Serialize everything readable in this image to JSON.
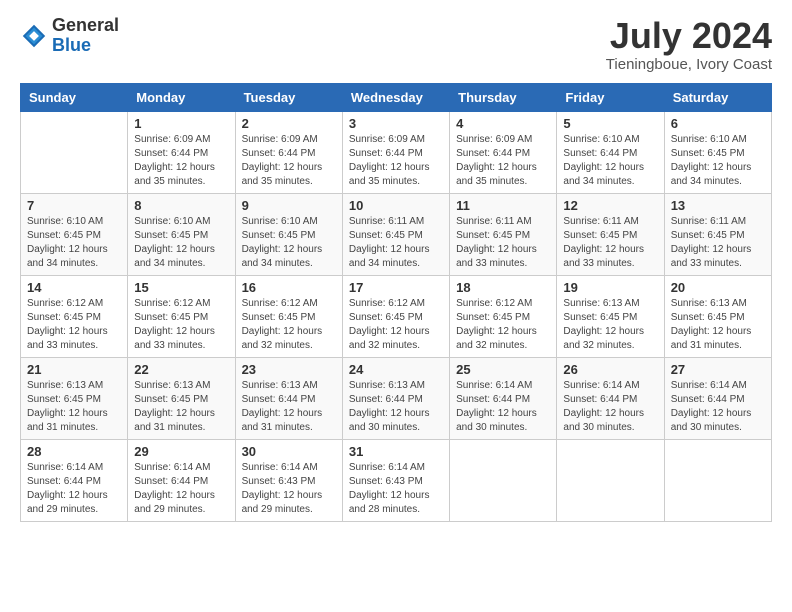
{
  "logo": {
    "general": "General",
    "blue": "Blue"
  },
  "title": "July 2024",
  "subtitle": "Tieningboue, Ivory Coast",
  "days_of_week": [
    "Sunday",
    "Monday",
    "Tuesday",
    "Wednesday",
    "Thursday",
    "Friday",
    "Saturday"
  ],
  "weeks": [
    [
      {
        "day": "",
        "sunrise": "",
        "sunset": "",
        "daylight": ""
      },
      {
        "day": "1",
        "sunrise": "Sunrise: 6:09 AM",
        "sunset": "Sunset: 6:44 PM",
        "daylight": "Daylight: 12 hours and 35 minutes."
      },
      {
        "day": "2",
        "sunrise": "Sunrise: 6:09 AM",
        "sunset": "Sunset: 6:44 PM",
        "daylight": "Daylight: 12 hours and 35 minutes."
      },
      {
        "day": "3",
        "sunrise": "Sunrise: 6:09 AM",
        "sunset": "Sunset: 6:44 PM",
        "daylight": "Daylight: 12 hours and 35 minutes."
      },
      {
        "day": "4",
        "sunrise": "Sunrise: 6:09 AM",
        "sunset": "Sunset: 6:44 PM",
        "daylight": "Daylight: 12 hours and 35 minutes."
      },
      {
        "day": "5",
        "sunrise": "Sunrise: 6:10 AM",
        "sunset": "Sunset: 6:44 PM",
        "daylight": "Daylight: 12 hours and 34 minutes."
      },
      {
        "day": "6",
        "sunrise": "Sunrise: 6:10 AM",
        "sunset": "Sunset: 6:45 PM",
        "daylight": "Daylight: 12 hours and 34 minutes."
      }
    ],
    [
      {
        "day": "7",
        "sunrise": "Sunrise: 6:10 AM",
        "sunset": "Sunset: 6:45 PM",
        "daylight": "Daylight: 12 hours and 34 minutes."
      },
      {
        "day": "8",
        "sunrise": "Sunrise: 6:10 AM",
        "sunset": "Sunset: 6:45 PM",
        "daylight": "Daylight: 12 hours and 34 minutes."
      },
      {
        "day": "9",
        "sunrise": "Sunrise: 6:10 AM",
        "sunset": "Sunset: 6:45 PM",
        "daylight": "Daylight: 12 hours and 34 minutes."
      },
      {
        "day": "10",
        "sunrise": "Sunrise: 6:11 AM",
        "sunset": "Sunset: 6:45 PM",
        "daylight": "Daylight: 12 hours and 34 minutes."
      },
      {
        "day": "11",
        "sunrise": "Sunrise: 6:11 AM",
        "sunset": "Sunset: 6:45 PM",
        "daylight": "Daylight: 12 hours and 33 minutes."
      },
      {
        "day": "12",
        "sunrise": "Sunrise: 6:11 AM",
        "sunset": "Sunset: 6:45 PM",
        "daylight": "Daylight: 12 hours and 33 minutes."
      },
      {
        "day": "13",
        "sunrise": "Sunrise: 6:11 AM",
        "sunset": "Sunset: 6:45 PM",
        "daylight": "Daylight: 12 hours and 33 minutes."
      }
    ],
    [
      {
        "day": "14",
        "sunrise": "Sunrise: 6:12 AM",
        "sunset": "Sunset: 6:45 PM",
        "daylight": "Daylight: 12 hours and 33 minutes."
      },
      {
        "day": "15",
        "sunrise": "Sunrise: 6:12 AM",
        "sunset": "Sunset: 6:45 PM",
        "daylight": "Daylight: 12 hours and 33 minutes."
      },
      {
        "day": "16",
        "sunrise": "Sunrise: 6:12 AM",
        "sunset": "Sunset: 6:45 PM",
        "daylight": "Daylight: 12 hours and 32 minutes."
      },
      {
        "day": "17",
        "sunrise": "Sunrise: 6:12 AM",
        "sunset": "Sunset: 6:45 PM",
        "daylight": "Daylight: 12 hours and 32 minutes."
      },
      {
        "day": "18",
        "sunrise": "Sunrise: 6:12 AM",
        "sunset": "Sunset: 6:45 PM",
        "daylight": "Daylight: 12 hours and 32 minutes."
      },
      {
        "day": "19",
        "sunrise": "Sunrise: 6:13 AM",
        "sunset": "Sunset: 6:45 PM",
        "daylight": "Daylight: 12 hours and 32 minutes."
      },
      {
        "day": "20",
        "sunrise": "Sunrise: 6:13 AM",
        "sunset": "Sunset: 6:45 PM",
        "daylight": "Daylight: 12 hours and 31 minutes."
      }
    ],
    [
      {
        "day": "21",
        "sunrise": "Sunrise: 6:13 AM",
        "sunset": "Sunset: 6:45 PM",
        "daylight": "Daylight: 12 hours and 31 minutes."
      },
      {
        "day": "22",
        "sunrise": "Sunrise: 6:13 AM",
        "sunset": "Sunset: 6:45 PM",
        "daylight": "Daylight: 12 hours and 31 minutes."
      },
      {
        "day": "23",
        "sunrise": "Sunrise: 6:13 AM",
        "sunset": "Sunset: 6:44 PM",
        "daylight": "Daylight: 12 hours and 31 minutes."
      },
      {
        "day": "24",
        "sunrise": "Sunrise: 6:13 AM",
        "sunset": "Sunset: 6:44 PM",
        "daylight": "Daylight: 12 hours and 30 minutes."
      },
      {
        "day": "25",
        "sunrise": "Sunrise: 6:14 AM",
        "sunset": "Sunset: 6:44 PM",
        "daylight": "Daylight: 12 hours and 30 minutes."
      },
      {
        "day": "26",
        "sunrise": "Sunrise: 6:14 AM",
        "sunset": "Sunset: 6:44 PM",
        "daylight": "Daylight: 12 hours and 30 minutes."
      },
      {
        "day": "27",
        "sunrise": "Sunrise: 6:14 AM",
        "sunset": "Sunset: 6:44 PM",
        "daylight": "Daylight: 12 hours and 30 minutes."
      }
    ],
    [
      {
        "day": "28",
        "sunrise": "Sunrise: 6:14 AM",
        "sunset": "Sunset: 6:44 PM",
        "daylight": "Daylight: 12 hours and 29 minutes."
      },
      {
        "day": "29",
        "sunrise": "Sunrise: 6:14 AM",
        "sunset": "Sunset: 6:44 PM",
        "daylight": "Daylight: 12 hours and 29 minutes."
      },
      {
        "day": "30",
        "sunrise": "Sunrise: 6:14 AM",
        "sunset": "Sunset: 6:43 PM",
        "daylight": "Daylight: 12 hours and 29 minutes."
      },
      {
        "day": "31",
        "sunrise": "Sunrise: 6:14 AM",
        "sunset": "Sunset: 6:43 PM",
        "daylight": "Daylight: 12 hours and 28 minutes."
      },
      {
        "day": "",
        "sunrise": "",
        "sunset": "",
        "daylight": ""
      },
      {
        "day": "",
        "sunrise": "",
        "sunset": "",
        "daylight": ""
      },
      {
        "day": "",
        "sunrise": "",
        "sunset": "",
        "daylight": ""
      }
    ]
  ]
}
